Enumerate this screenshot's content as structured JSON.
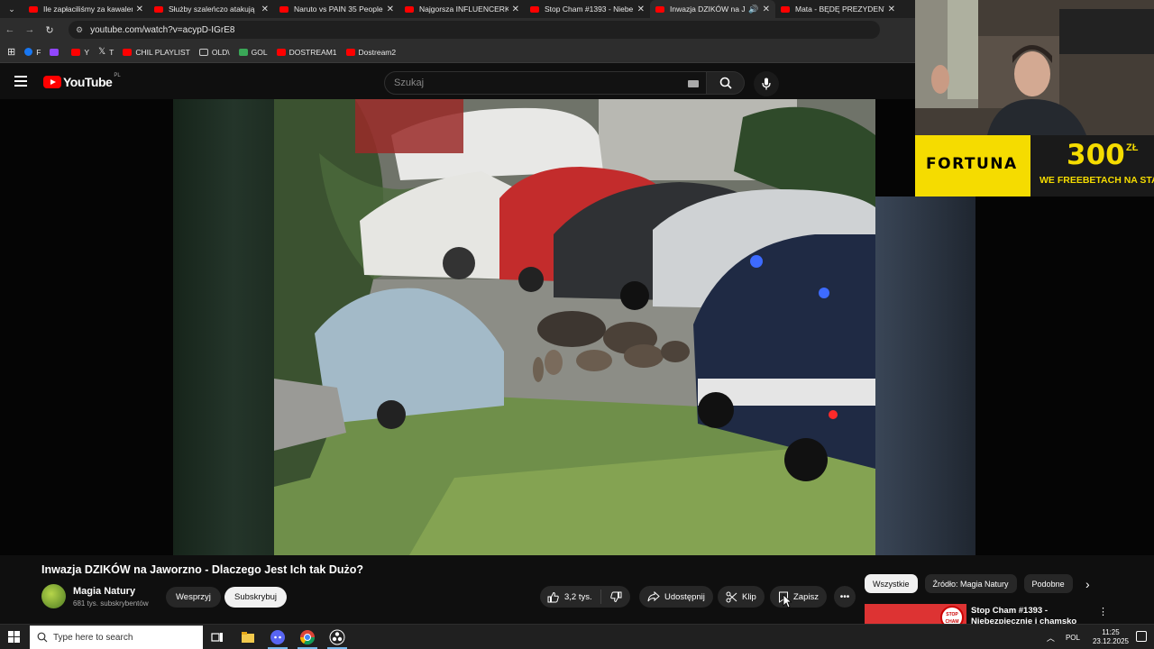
{
  "browser": {
    "tabs": [
      {
        "title": "Ile zapłaciliśmy za kawalerkę",
        "active": false
      },
      {
        "title": "Służby szaleńczo atakują",
        "active": false
      },
      {
        "title": "Naruto vs PAIN 35 People",
        "active": false
      },
      {
        "title": "Najgorsza INFLUENCERKA",
        "active": false
      },
      {
        "title": "Stop Cham #1393 - Niebe",
        "active": false
      },
      {
        "title": "Inwazja DZIKÓW na Ja",
        "active": true
      },
      {
        "title": "Mata - BĘDĘ PREZYDENT",
        "active": false
      }
    ],
    "address": "youtube.com/watch?v=acypD-IGrE8",
    "bookmarks": [
      {
        "label": "F",
        "color": "#1877f2"
      },
      {
        "label": "Y",
        "color": "#ff0000"
      },
      {
        "label": "T",
        "color": "#000000"
      },
      {
        "label": "CHIL PLAYLIST",
        "color": "#ff0000"
      },
      {
        "label": "OLD\\",
        "color": "folder"
      },
      {
        "label": "GOL",
        "color": "#3aa757"
      },
      {
        "label": "DOSTREAM1",
        "color": "#ff0000"
      },
      {
        "label": "Dostream2",
        "color": "#ff0000"
      }
    ]
  },
  "youtube": {
    "logo_text": "YouTube",
    "region": "PL",
    "search_placeholder": "Szukaj"
  },
  "overlay": {
    "ad_brand": "FORTUNA",
    "ad_amount": "300",
    "ad_amount_unit": "ZŁ",
    "ad_promo": "WE FREEBETACH NA STARV"
  },
  "video": {
    "title": "Inwazja DZIKÓW na Jaworzno - Dlaczego Jest Ich tak Dużo?",
    "channel_name": "Magia Natury",
    "subscribers": "681 tys. subskrybentów",
    "support_label": "Wesprzyj",
    "subscribe_label": "Subskrybuj",
    "likes": "3,2 tys.",
    "share_label": "Udostępnij",
    "clip_label": "Klip",
    "save_label": "Zapisz"
  },
  "sidebar": {
    "chips": [
      "Wszystkie",
      "Źródło: Magia Natury",
      "Podobne"
    ],
    "rec_title": "Stop Cham #1393 - Niebezpiecznie i chamsko",
    "rec_badge": "STOP CHAM"
  },
  "taskbar": {
    "search_placeholder": "Type here to search",
    "language": "POL",
    "time": "11:25",
    "date": "23.12.2025"
  }
}
